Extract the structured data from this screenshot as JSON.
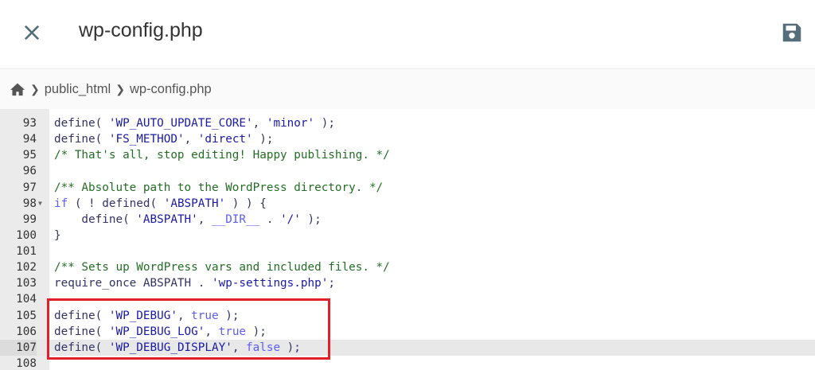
{
  "header": {
    "title": "wp-config.php",
    "close_icon": "close-icon",
    "save_icon": "floppy-disk-save-icon"
  },
  "breadcrumb": {
    "home_icon": "home-icon",
    "items": [
      "public_html",
      "wp-config.php"
    ]
  },
  "editor": {
    "active_line": 107,
    "highlight_color": "#e3202a",
    "highlighted_lines": [
      105,
      107
    ],
    "lines": [
      {
        "n": "93",
        "tokens": [
          [
            "plain",
            "define( "
          ],
          [
            "str",
            "'WP_AUTO_UPDATE_CORE'"
          ],
          [
            "plain",
            ", "
          ],
          [
            "str",
            "'minor'"
          ],
          [
            "plain",
            " );"
          ]
        ]
      },
      {
        "n": "94",
        "tokens": [
          [
            "plain",
            "define( "
          ],
          [
            "str",
            "'FS_METHOD'"
          ],
          [
            "plain",
            ", "
          ],
          [
            "str",
            "'direct'"
          ],
          [
            "plain",
            " );"
          ]
        ]
      },
      {
        "n": "95",
        "tokens": [
          [
            "cm",
            "/* That's all, stop editing! Happy publishing. */"
          ]
        ]
      },
      {
        "n": "96",
        "tokens": []
      },
      {
        "n": "97",
        "tokens": [
          [
            "cm",
            "/** Absolute path to the WordPress directory. */"
          ]
        ]
      },
      {
        "n": "98",
        "fold": true,
        "tokens": [
          [
            "kw",
            "if"
          ],
          [
            "plain",
            " ( ! defined( "
          ],
          [
            "str",
            "'ABSPATH'"
          ],
          [
            "plain",
            " ) ) {"
          ]
        ]
      },
      {
        "n": "99",
        "tokens": [
          [
            "plain",
            "    define( "
          ],
          [
            "str",
            "'ABSPATH'"
          ],
          [
            "plain",
            ", "
          ],
          [
            "kw",
            "__DIR__"
          ],
          [
            "plain",
            " . "
          ],
          [
            "str",
            "'/'"
          ],
          [
            "plain",
            " );"
          ]
        ]
      },
      {
        "n": "100",
        "tokens": [
          [
            "plain",
            "}"
          ]
        ]
      },
      {
        "n": "101",
        "tokens": []
      },
      {
        "n": "102",
        "tokens": [
          [
            "cm",
            "/** Sets up WordPress vars and included files. */"
          ]
        ]
      },
      {
        "n": "103",
        "tokens": [
          [
            "plain",
            "require_once ABSPATH . "
          ],
          [
            "str",
            "'wp-settings.php'"
          ],
          [
            "plain",
            ";"
          ]
        ]
      },
      {
        "n": "104",
        "tokens": []
      },
      {
        "n": "105",
        "tokens": [
          [
            "plain",
            "define( "
          ],
          [
            "str",
            "'WP_DEBUG'"
          ],
          [
            "plain",
            ", "
          ],
          [
            "kw",
            "true"
          ],
          [
            "plain",
            " );"
          ]
        ]
      },
      {
        "n": "106",
        "tokens": [
          [
            "plain",
            "define( "
          ],
          [
            "str",
            "'WP_DEBUG_LOG'"
          ],
          [
            "plain",
            ", "
          ],
          [
            "kw",
            "true"
          ],
          [
            "plain",
            " );"
          ]
        ]
      },
      {
        "n": "107",
        "tokens": [
          [
            "plain",
            "define( "
          ],
          [
            "str",
            "'WP_DEBUG_DISPLAY'"
          ],
          [
            "plain",
            ", "
          ],
          [
            "kw",
            "false"
          ],
          [
            "plain",
            " );"
          ]
        ]
      },
      {
        "n": "108",
        "tokens": []
      }
    ]
  }
}
